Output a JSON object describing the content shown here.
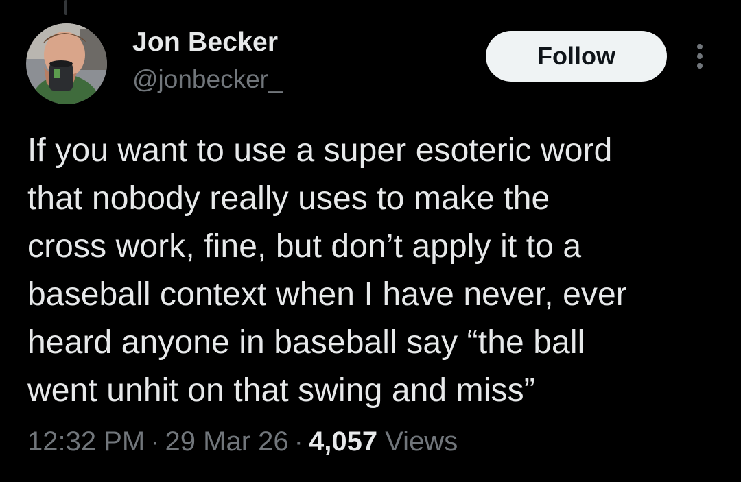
{
  "tweet": {
    "author": {
      "name": "Jon Becker",
      "handle": "@jonbecker_",
      "avatar_icon": "profile-photo-person-drinking-from-mug"
    },
    "follow_label": "Follow",
    "more_icon": "more-options-vertical-dots-icon",
    "text": "If you want to use a super esoteric word\nthat nobody really uses to make the\ncross work, fine, but don’t apply it to a\nbaseball context when I have never, ever\nheard anyone in baseball say “the ball\nwent unhit on that swing and miss”",
    "time": "12:32 PM",
    "date": "29 Mar 26",
    "separator": "·",
    "views_count": "4,057",
    "views_label": "Views"
  },
  "colors": {
    "background": "#000000",
    "primary_text": "#e7e9ea",
    "secondary_text": "#71767b",
    "follow_button_bg": "#eff3f4",
    "follow_button_text": "#0f1419"
  }
}
